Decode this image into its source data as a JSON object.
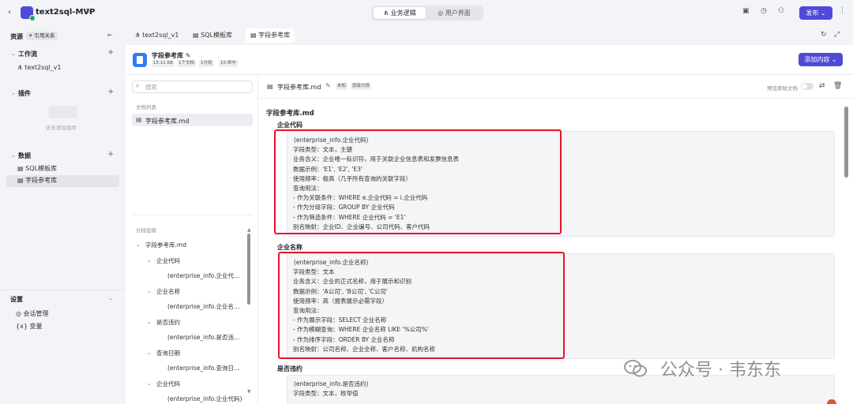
{
  "app": {
    "title": "text2sql-MVP",
    "modes": [
      "业务逻辑",
      "用户界面"
    ],
    "publish_label": "发布",
    "accent": "#4e4bd8"
  },
  "sidebar": {
    "resources_title": "资源",
    "ref_chip": "引用关系",
    "sections": [
      {
        "title": "工作流",
        "items": [
          "text2sql_v1"
        ]
      },
      {
        "title": "插件",
        "empty_text": "还未添加插件"
      },
      {
        "title": "数据",
        "items": [
          "SQL模板库",
          "字段参考库"
        ]
      }
    ],
    "settings_title": "设置",
    "settings_items": [
      "会话管理",
      "变量"
    ]
  },
  "tabs": [
    "text2sql_v1",
    "SQL模板库",
    "字段参考库"
  ],
  "doc_header": {
    "title": "字段参考库",
    "chips": [
      "15.11 KB",
      "1个文档",
      "1分组",
      "10 命中"
    ],
    "add_label": "添加内容"
  },
  "file_list": {
    "search_placeholder": "搜索",
    "doc_list_label": "文档列表",
    "doc_item": "字段参考库.md",
    "segment_label": "分段层级",
    "segments": [
      {
        "text": "字段参考库.md",
        "level": 0
      },
      {
        "text": "企业代码",
        "level": 1
      },
      {
        "text": "(enterprise_info.企业代…",
        "level": 2
      },
      {
        "text": "企业名称",
        "level": 1
      },
      {
        "text": "(enterprise_info.企业名…",
        "level": 2
      },
      {
        "text": "是否违约",
        "level": 1
      },
      {
        "text": "(enterprise_info.是否违…",
        "level": 2
      },
      {
        "text": "查询日期",
        "level": 1
      },
      {
        "text": "(enterprise_info.查询日…",
        "level": 2
      },
      {
        "text": "企业代码",
        "level": 1
      },
      {
        "text": "(enterprise_info.企业代码)",
        "level": 2
      }
    ]
  },
  "content": {
    "file_title": "字段参考库.md",
    "tags": [
      "未知",
      "层级分段"
    ],
    "preview_label": "预览原始文档",
    "md_title": "字段参考库.md",
    "blocks": [
      {
        "heading": "企业代码",
        "lines": [
          "(enterprise_info.企业代码)",
          "字段类型：文本，主键",
          "业务含义：企业唯一标识符，用于关联企业信息表和发票信息表",
          "数据示例：'E1', 'E2', 'E3'",
          "使用频率：极高（几乎所有查询的关联字段）",
          "查询用法：",
          "- 作为关联条件：WHERE e.企业代码 = i.企业代码",
          "- 作为分组字段：GROUP BY 企业代码",
          "- 作为筛选条件：WHERE 企业代码 = 'E1'",
          "别名映射：企业ID、企业编号、公司代码、客户代码"
        ]
      },
      {
        "heading": "企业名称",
        "lines": [
          "(enterprise_info.企业名称)",
          "字段类型：文本",
          "业务含义：企业的正式名称，用于展示和识别",
          "数据示例：'A公司', 'B公司', 'C公司'",
          "使用频率：高（报表展示必需字段）",
          "查询用法：",
          "- 作为展示字段：SELECT 企业名称",
          "- 作为模糊查询：WHERE 企业名称 LIKE '%公司%'",
          "- 作为排序字段：ORDER BY 企业名称",
          "别名映射：公司名称、企业全称、客户名称、机构名称"
        ]
      },
      {
        "heading": "是否违约",
        "lines": [
          "(enterprise_info.是否违约)",
          "字段类型：文本，枚举值"
        ]
      }
    ]
  },
  "watermark": "公众号 · 韦东东"
}
